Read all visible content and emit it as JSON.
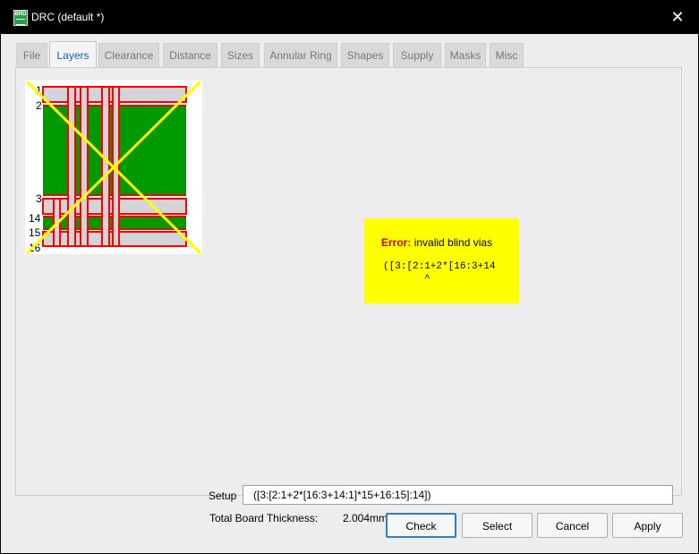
{
  "window": {
    "title": "DRC (default *)",
    "app_icon_text": "BRD",
    "close_glyph": "✕"
  },
  "tabs": [
    {
      "label": "File",
      "active": false
    },
    {
      "label": "Layers",
      "active": true
    },
    {
      "label": "Clearance",
      "active": false
    },
    {
      "label": "Distance",
      "active": false
    },
    {
      "label": "Sizes",
      "active": false
    },
    {
      "label": "Annular Ring",
      "active": false
    },
    {
      "label": "Shapes",
      "active": false
    },
    {
      "label": "Supply",
      "active": false
    },
    {
      "label": "Masks",
      "active": false
    },
    {
      "label": "Misc",
      "active": false
    }
  ],
  "layer_stack": {
    "layer_numbers": [
      "1",
      "2",
      "3",
      "14",
      "15",
      "16"
    ],
    "invalid_marker": "yellow-cross",
    "colors": {
      "core": "#009900",
      "prepreg": "#d4d4d8",
      "copper_outline": "#ff0000",
      "cross": "#ffff00"
    }
  },
  "error": {
    "label": "Error:",
    "message": "invalid blind vias",
    "code": "([3:[2:1+2*[16:3+14",
    "caret": "^"
  },
  "setup": {
    "label": "Setup",
    "value": "([3:[2:1+2*[16:3+14:1]*15+16:15]:14])"
  },
  "thickness": {
    "label": "Total Board Thickness:",
    "value": "2.004mm"
  },
  "buttons": {
    "check": "Check",
    "select": "Select",
    "cancel": "Cancel",
    "apply": "Apply"
  }
}
